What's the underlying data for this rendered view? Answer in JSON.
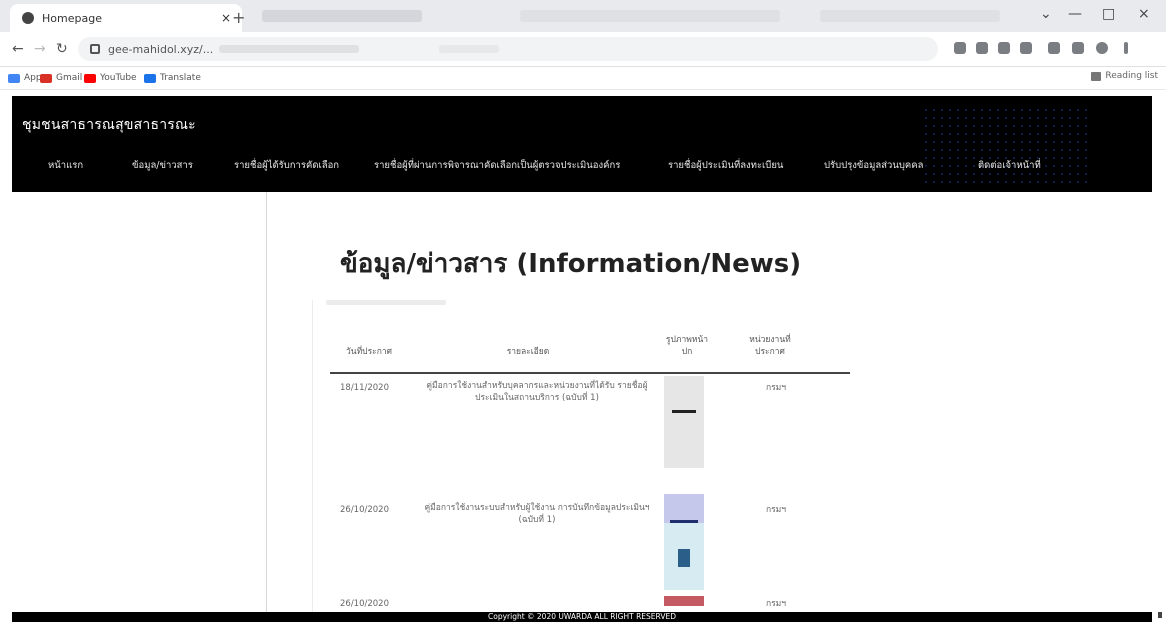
{
  "browser": {
    "tab_title": "Homepage",
    "tab_close": "×",
    "new_tab": "+",
    "window_controls": [
      "⌄",
      "—",
      "□",
      "×"
    ],
    "url": "gee-mahidol.xyz/...",
    "bookmarks": [
      {
        "label": "Apps",
        "color": "#4285f4"
      },
      {
        "label": "Gmail",
        "color": "#d93025"
      },
      {
        "label": "YouTube",
        "color": "#ff0000"
      },
      {
        "label": "Translate",
        "color": "#1a73e8"
      }
    ],
    "reading_list": "Reading list"
  },
  "site": {
    "title": "ชุมชนสาธารณสุขสาธารณะ",
    "nav": [
      "หน้าแรก",
      "ข้อมูล/ข่าวสาร",
      "รายชื่อผู้ได้รับการคัดเลือก",
      "รายชื่อผู้ที่ผ่านการพิจารณาคัดเลือกเป็นผู้ตรวจประเมินองค์กร",
      "รายชื่อผู้ประเมินที่ลงทะเบียน",
      "ปรับปรุงข้อมูลส่วนบุคคล",
      "ติดต่อเจ้าหน้าที่"
    ]
  },
  "page": {
    "heading": "ข้อมูล/ข่าวสาร (Information/News)"
  },
  "table": {
    "headers": [
      "วันที่ประกาศ",
      "รายละเอียด",
      "รูปภาพหน้าปก",
      "หน่วยงานที่ประกาศ"
    ],
    "rows": [
      {
        "date": "18/11/2020",
        "detail": "คู่มือการใช้งานสำหรับบุคลากรและหน่วยงานที่ได้รับ รายชื่อผู้ประเมินในสถานบริการ (ฉบับที่ 1)",
        "org": "กรมฯ"
      },
      {
        "date": "26/10/2020",
        "detail": "คู่มือการใช้งานระบบสำหรับผู้ใช้งาน การบันทึกข้อมูลประเมินฯ (ฉบับที่ 1)",
        "org": "กรมฯ"
      },
      {
        "date": "26/10/2020",
        "detail": "",
        "org": "กรมฯ"
      }
    ]
  },
  "footer": {
    "copyright": "Copyright © 2020 UWARDA ALL RIGHT RESERVED"
  },
  "colors": {
    "header_bg": "#000000",
    "page_bg": "#ffffff",
    "accent_dots": "#1b2f80"
  }
}
